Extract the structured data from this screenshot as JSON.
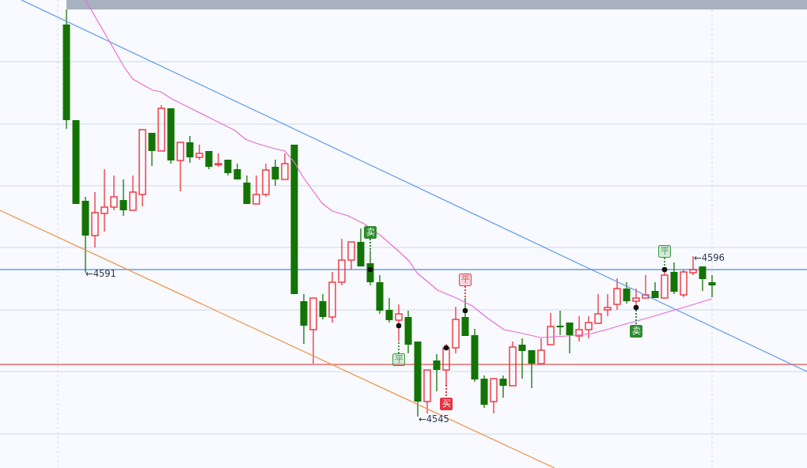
{
  "chart": {
    "price_labels": [
      {
        "text": "←4591"
      },
      {
        "text": "←4545"
      },
      {
        "text": "←4596"
      }
    ],
    "signals": [
      {
        "label": "卖",
        "color": "#2f8a2f",
        "filled": true
      },
      {
        "label": "平",
        "color": "#3f9a3f",
        "filled": false
      },
      {
        "label": "买",
        "color": "#e8313f",
        "filled": true
      },
      {
        "label": "平",
        "color": "#e8404c",
        "filled": false
      },
      {
        "label": "卖",
        "color": "#2f8a2f",
        "filled": true
      },
      {
        "label": "平",
        "color": "#3f9a3f",
        "filled": false
      }
    ]
  }
}
